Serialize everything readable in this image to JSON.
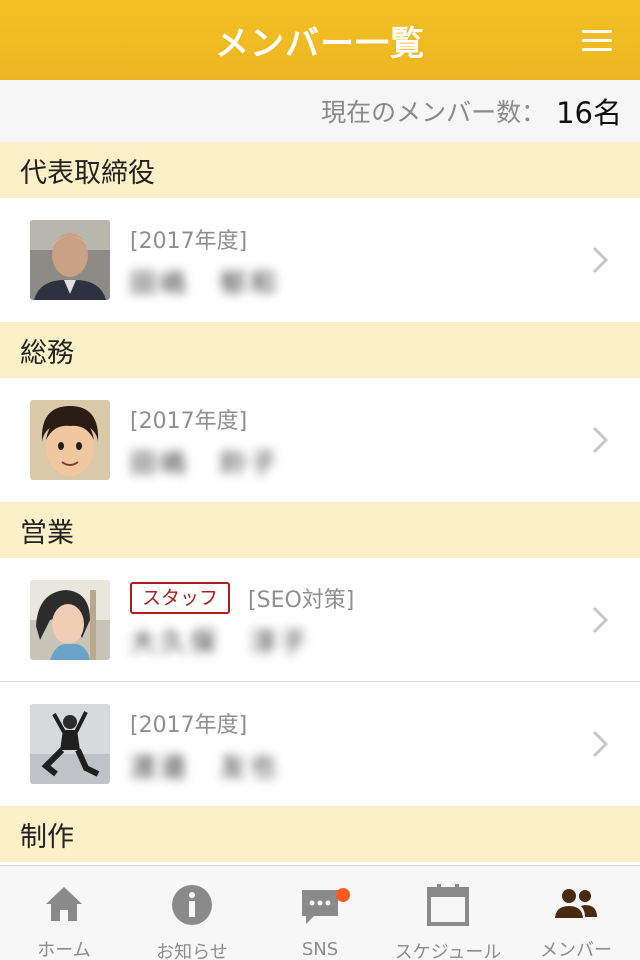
{
  "header": {
    "title": "メンバー一覧"
  },
  "count": {
    "label": "現在のメンバー数：",
    "value": "16名"
  },
  "sections": [
    {
      "title": "代表取締役",
      "members": [
        {
          "tag": "",
          "year": "[2017年度]",
          "name": "田嶋　郁和"
        }
      ]
    },
    {
      "title": "総務",
      "members": [
        {
          "tag": "",
          "year": "[2017年度]",
          "name": "田嶋　鈴子"
        }
      ]
    },
    {
      "title": "営業",
      "members": [
        {
          "tag": "スタッフ",
          "year": "[SEO対策]",
          "name": "大久保　淳子"
        },
        {
          "tag": "",
          "year": "[2017年度]",
          "name": "渡邊　友也"
        }
      ]
    },
    {
      "title": "制作",
      "members": []
    }
  ],
  "tabs": [
    {
      "label": "ホーム",
      "icon": "home-icon"
    },
    {
      "label": "お知らせ",
      "icon": "info-icon"
    },
    {
      "label": "SNS",
      "icon": "chat-icon"
    },
    {
      "label": "スケジュール",
      "icon": "calendar-icon"
    },
    {
      "label": "メンバー",
      "icon": "members-icon"
    }
  ],
  "colors": {
    "header": "#efb823",
    "section": "#fbf0c8",
    "tag": "#b01c1c",
    "badge": "#ff5a1f",
    "active_tab": "#4a2a12",
    "inactive_tab": "#8a8a8a"
  }
}
